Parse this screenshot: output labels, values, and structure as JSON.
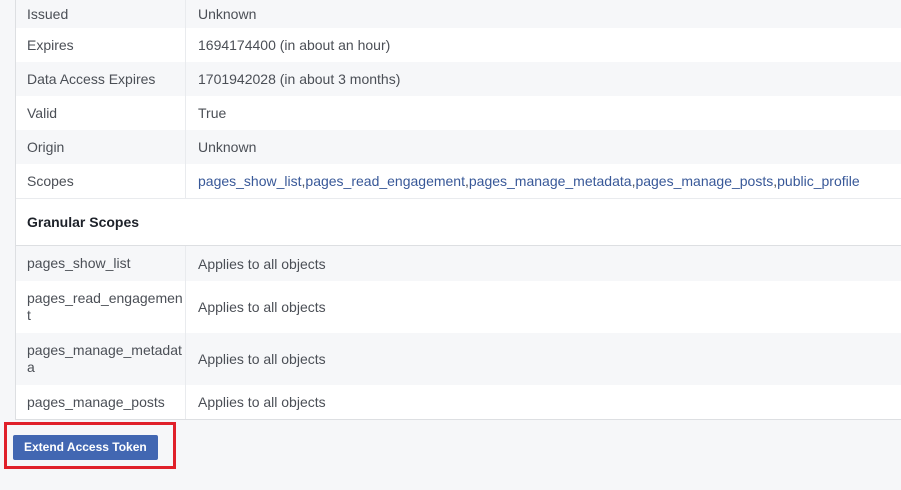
{
  "info_rows": [
    {
      "label": "Issued",
      "value": "Unknown"
    },
    {
      "label": "Expires",
      "value": "1694174400 (in about an hour)"
    },
    {
      "label": "Data Access Expires",
      "value": "1701942028 (in about 3 months)"
    },
    {
      "label": "Valid",
      "value": "True"
    },
    {
      "label": "Origin",
      "value": "Unknown"
    }
  ],
  "scopes": {
    "label": "Scopes",
    "items": [
      "pages_show_list",
      "pages_read_engagement",
      "pages_manage_metadata",
      "pages_manage_posts",
      "public_profile"
    ],
    "separator": ", "
  },
  "granular": {
    "title": "Granular Scopes",
    "rows": [
      {
        "label": "pages_show_list",
        "value": "Applies to all objects"
      },
      {
        "label": "pages_read_engagement",
        "value": "Applies to all objects"
      },
      {
        "label": "pages_manage_metadata",
        "value": "Applies to all objects"
      },
      {
        "label": "pages_manage_posts",
        "value": "Applies to all objects"
      }
    ]
  },
  "actions": {
    "extend_label": "Extend Access Token"
  },
  "colors": {
    "link": "#385898",
    "button": "#4267b2",
    "highlight": "#e0202a"
  }
}
